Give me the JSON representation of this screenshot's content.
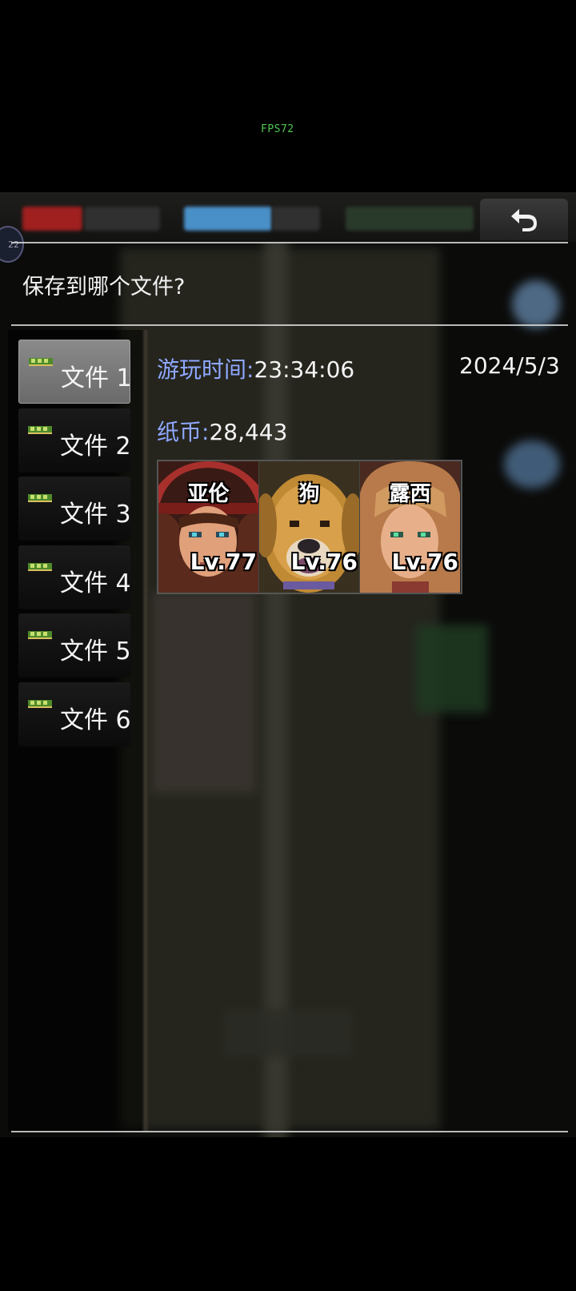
{
  "fps_text": "FPS72",
  "header": {
    "title": "保存到哪个文件?",
    "badge_text": "22",
    "back_icon": "back-arrow-icon"
  },
  "slots": [
    {
      "label": "文件 1",
      "active": true,
      "icon": "memory-chip-icon"
    },
    {
      "label": "文件 2",
      "active": false,
      "icon": "memory-chip-icon"
    },
    {
      "label": "文件 3",
      "active": false,
      "icon": "memory-chip-icon"
    },
    {
      "label": "文件 4",
      "active": false,
      "icon": "memory-chip-icon"
    },
    {
      "label": "文件 5",
      "active": false,
      "icon": "memory-chip-icon"
    },
    {
      "label": "文件 6",
      "active": false,
      "icon": "memory-chip-icon"
    }
  ],
  "details": {
    "playtime_label": "游玩时间:",
    "playtime_value": "23:34:06",
    "date": "2024/5/3",
    "money_label": "纸币:",
    "money_value": "28,443"
  },
  "party": [
    {
      "name": "亚伦",
      "level": "Lv.77"
    },
    {
      "name": "狗",
      "level": "Lv.76"
    },
    {
      "name": "露西",
      "level": "Lv.76"
    }
  ],
  "colors": {
    "accent_label": "#8fa8ff",
    "fps": "#4fc84f"
  }
}
